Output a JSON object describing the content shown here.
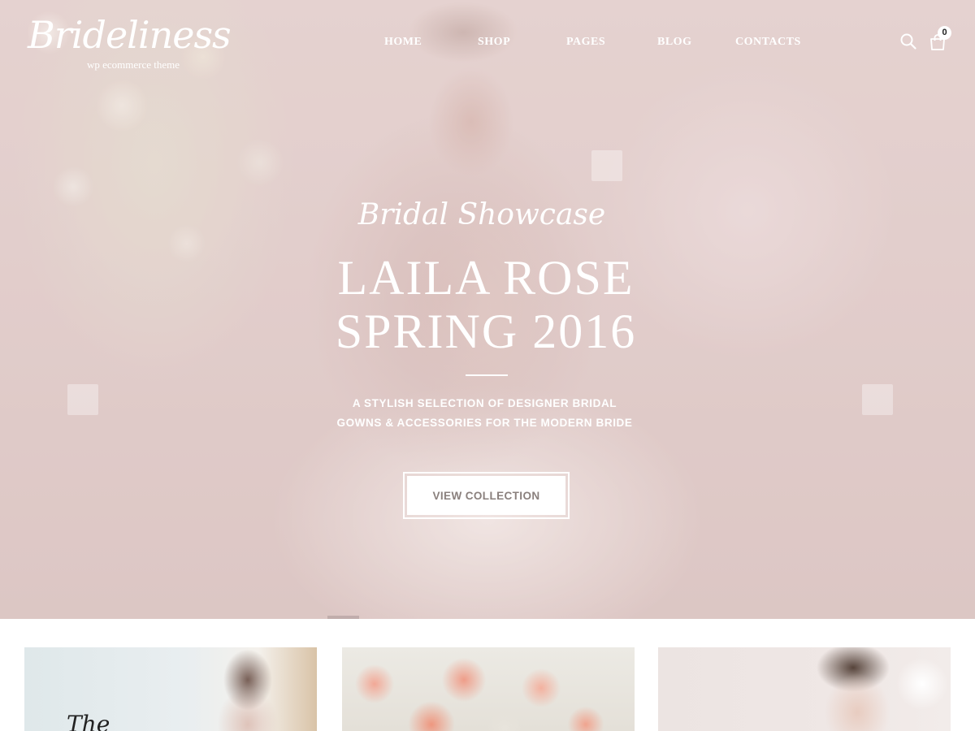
{
  "brand": {
    "name": "Brideliness",
    "tagline": "wp ecommerce theme"
  },
  "nav": {
    "items": [
      "HOME",
      "SHOP",
      "PAGES",
      "BLOG",
      "CONTACTS"
    ]
  },
  "header": {
    "search_icon": "search-icon",
    "cart_icon": "shopping-bag-icon",
    "cart_count": "0"
  },
  "hero": {
    "script_heading": "Bridal Showcase",
    "title_line1": "LAILA ROSE",
    "title_line2": "SPRING 2016",
    "description_line1": "A STYLISH SELECTION OF DESIGNER BRIDAL",
    "description_line2": "GOWNS & ACCESSORIES FOR THE MODERN BRIDE",
    "cta_label": "VIEW COLLECTION"
  },
  "cards": [
    {
      "text": "The"
    },
    {
      "text": ""
    },
    {
      "text": ""
    }
  ],
  "colors": {
    "hero_tint": "#e3cfce",
    "text_light": "#ffffff",
    "cta_text": "#8a807d"
  }
}
